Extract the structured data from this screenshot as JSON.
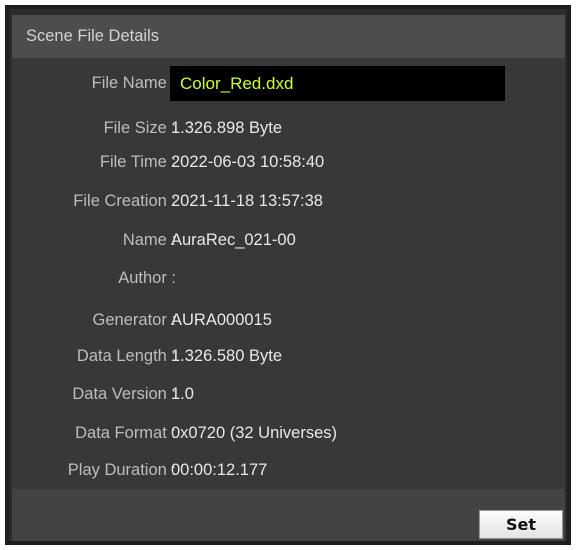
{
  "panel": {
    "title": "Scene File Details"
  },
  "details": [
    {
      "label": "File Name :",
      "value": "Color_Red.dxd"
    },
    {
      "label": "File Size :",
      "value": "1.326.898 Byte"
    },
    {
      "label": "File Time :",
      "value": "2022-06-03 10:58:40"
    },
    {
      "label": "File Creation :",
      "value": "2021-11-18 13:57:38"
    },
    {
      "label": "Name :",
      "value": "AuraRec_021-00"
    },
    {
      "label": "Author :",
      "value": ""
    },
    {
      "label": "Generator :",
      "value": "AURA000015"
    },
    {
      "label": "Data Length :",
      "value": "1.326.580 Byte"
    },
    {
      "label": "Data Version :",
      "value": "1.0"
    },
    {
      "label": "Data Format :",
      "value": "0x0720 (32 Universes)"
    },
    {
      "label": "Play Duration :",
      "value": "00:00:12.177"
    }
  ],
  "footer": {
    "set_label": "Set"
  },
  "colors": {
    "filename_text": "#ccff33",
    "panel_background": "#383838",
    "title_background": "#4d4d4d"
  }
}
